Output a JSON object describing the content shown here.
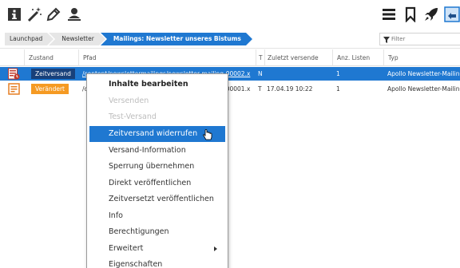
{
  "toolbar": {
    "icons": [
      "info-icon",
      "magic-wand-icon",
      "pencil-icon",
      "user-icon",
      "hamburger-menu-icon",
      "bookmark-icon",
      "rocket-icon",
      "publish-icon"
    ]
  },
  "breadcrumb": {
    "items": [
      "Launchpad",
      "Newsletter",
      "Mailings: Newsletter unseres Bistums"
    ]
  },
  "filter": {
    "placeholder": "Filter"
  },
  "table": {
    "headers": {
      "zustand": "Zustand",
      "pfad": "Pfad",
      "t": "T",
      "zuletzt": "Zuletzt versendet",
      "sort_indicator": "▲",
      "anz": "Anz. Listen",
      "typ": "Typ"
    },
    "rows": [
      {
        "status": "Zeitversand",
        "path": "/content/newslettermailings/newsletter-mailing-00002.x",
        "t": "N",
        "sent": "",
        "lists": "1",
        "type": "Apollo Newsletter-Mailing"
      },
      {
        "status": "Verändert",
        "path": "/content/newslettermailings/newsletter-mailing-00001.x",
        "t": "T",
        "sent": "17.04.19 10:22",
        "lists": "1",
        "type": "Apollo Newsletter-Mailing"
      }
    ]
  },
  "context_menu": {
    "items": [
      {
        "label": "Inhalte bearbeiten"
      },
      {
        "label": "Versenden"
      },
      {
        "label": "Test-Versand"
      },
      {
        "label": "Zeitversand widerrufen"
      },
      {
        "label": "Versand-Information"
      },
      {
        "label": "Sperrung übernehmen"
      },
      {
        "label": "Direkt veröffentlichen"
      },
      {
        "label": "Zeitversetzt veröffentlichen"
      },
      {
        "label": "Info"
      },
      {
        "label": "Berechtigungen"
      },
      {
        "label": "Erweitert"
      },
      {
        "label": "Eigenschaften"
      }
    ]
  },
  "colors": {
    "accent": "#1f78d1",
    "status_scheduled": "#18407a",
    "status_changed": "#f59a23"
  }
}
